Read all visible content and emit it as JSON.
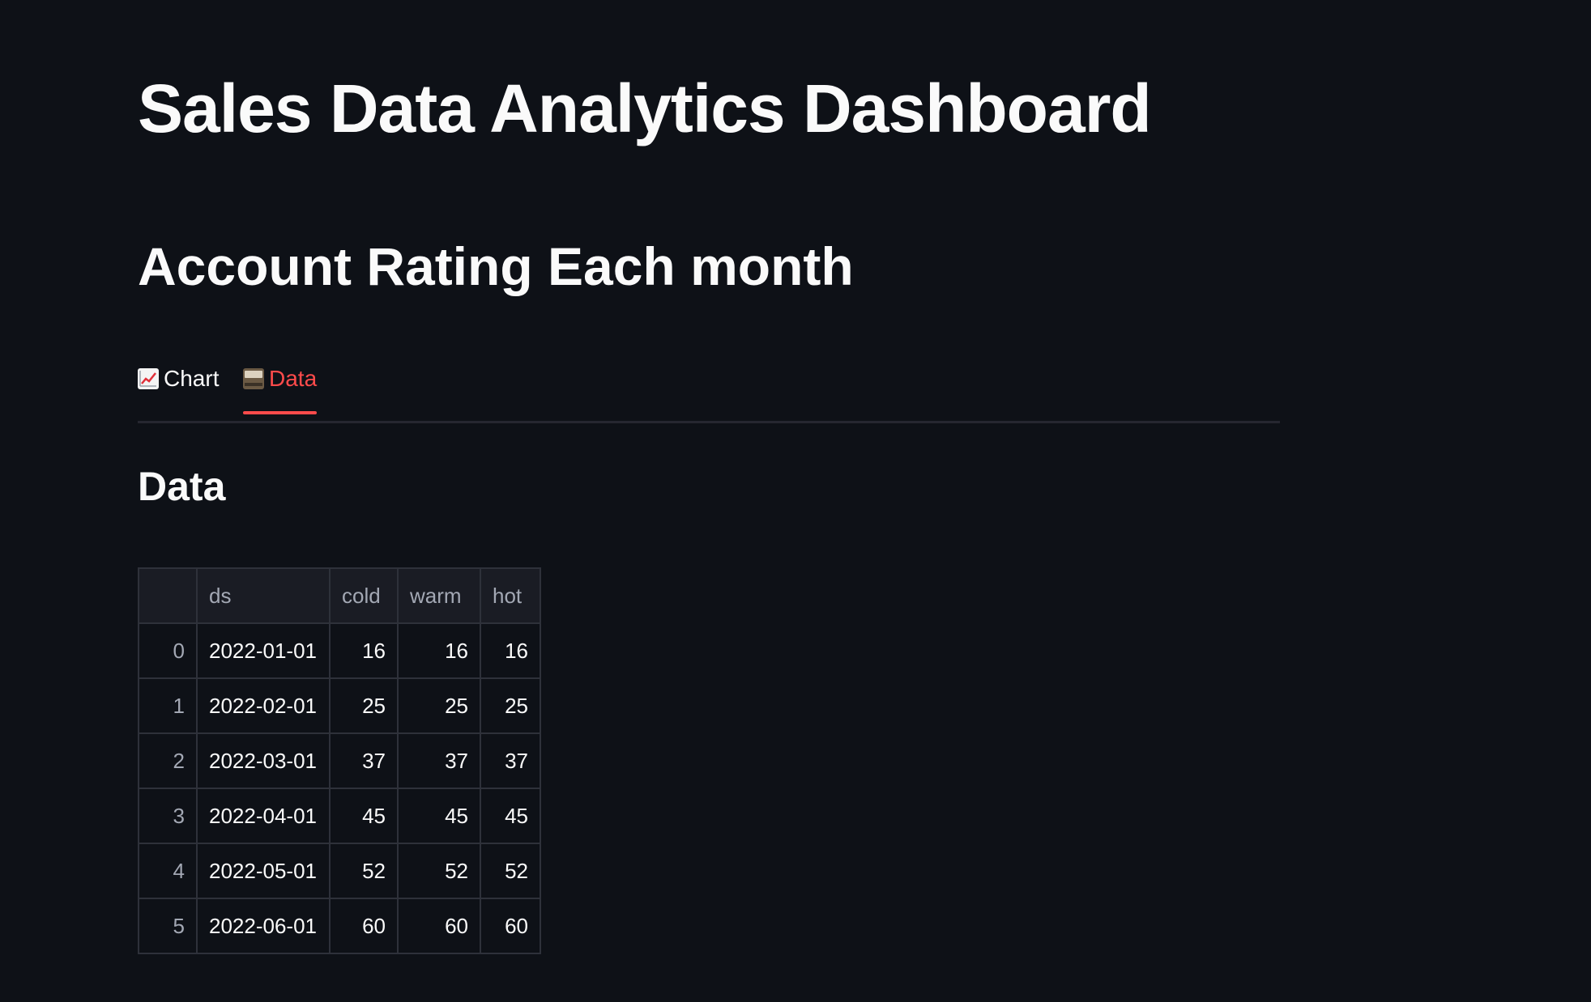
{
  "page": {
    "title": "Sales Data Analytics Dashboard",
    "subheader": "Account Rating Each month"
  },
  "tabs": [
    {
      "icon": "chart-increasing-icon",
      "label": "Chart",
      "active": false
    },
    {
      "icon": "card-file-box-icon",
      "label": "Data",
      "active": true
    }
  ],
  "data_section": {
    "heading": "Data"
  },
  "table": {
    "columns": [
      "",
      "ds",
      "cold",
      "warm",
      "hot"
    ],
    "rows": [
      {
        "index": "0",
        "ds": "2022-01-01",
        "cold": "16",
        "warm": "16",
        "hot": "16"
      },
      {
        "index": "1",
        "ds": "2022-02-01",
        "cold": "25",
        "warm": "25",
        "hot": "25"
      },
      {
        "index": "2",
        "ds": "2022-03-01",
        "cold": "37",
        "warm": "37",
        "hot": "37"
      },
      {
        "index": "3",
        "ds": "2022-04-01",
        "cold": "45",
        "warm": "45",
        "hot": "45"
      },
      {
        "index": "4",
        "ds": "2022-05-01",
        "cold": "52",
        "warm": "52",
        "hot": "52"
      },
      {
        "index": "5",
        "ds": "2022-06-01",
        "cold": "60",
        "warm": "60",
        "hot": "60"
      }
    ]
  },
  "colors": {
    "background": "#0e1117",
    "text": "#fafafa",
    "accent": "#ff4b4b",
    "table_border": "#2e313a",
    "header_bg": "#1a1c24"
  }
}
